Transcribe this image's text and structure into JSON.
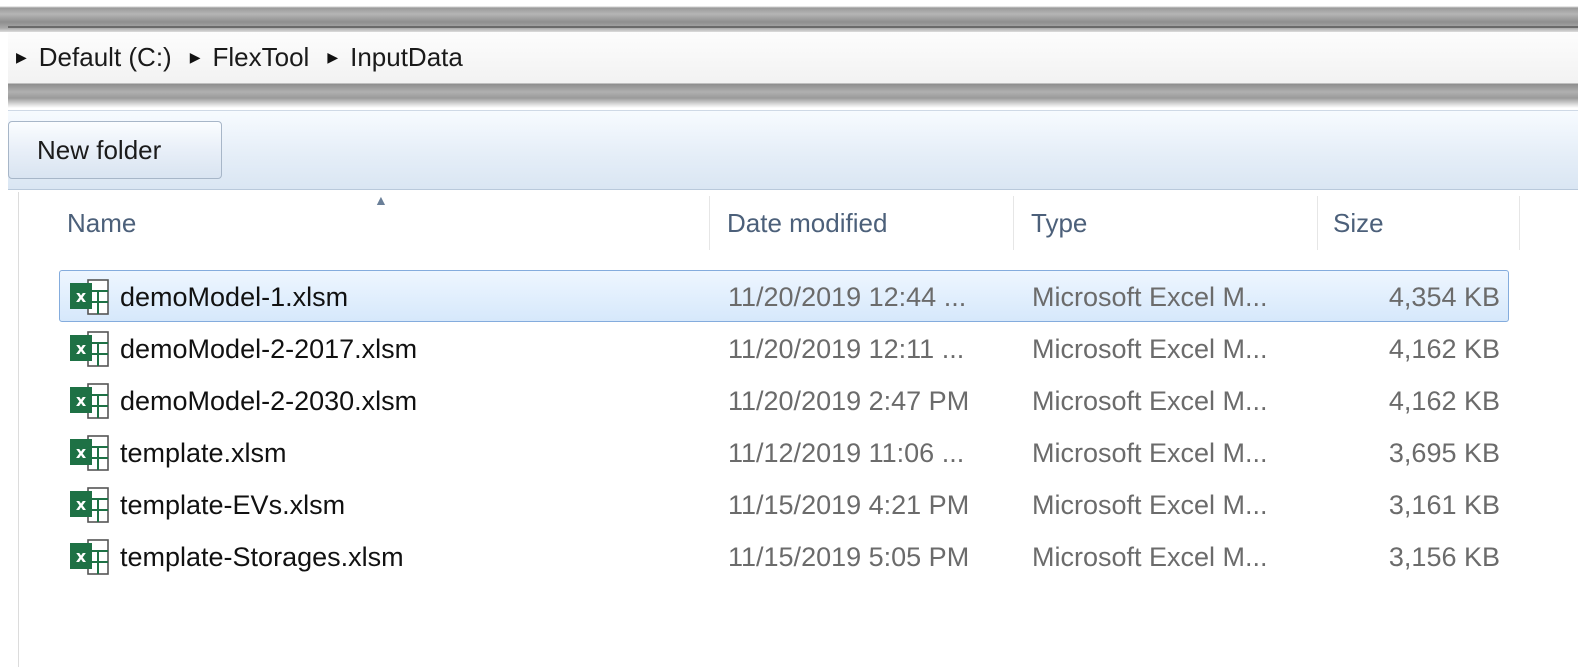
{
  "breadcrumb": {
    "items": [
      "Default (C:)",
      "FlexTool",
      "InputData"
    ]
  },
  "toolbar": {
    "new_folder_label": "New folder"
  },
  "columns": {
    "name": "Name",
    "date": "Date modified",
    "type": "Type",
    "size": "Size"
  },
  "files": [
    {
      "name": "demoModel-1.xlsm",
      "date": "11/20/2019 12:44 ...",
      "type": "Microsoft Excel M...",
      "size": "4,354 KB",
      "selected": true
    },
    {
      "name": "demoModel-2-2017.xlsm",
      "date": "11/20/2019 12:11 ...",
      "type": "Microsoft Excel M...",
      "size": "4,162 KB",
      "selected": false
    },
    {
      "name": "demoModel-2-2030.xlsm",
      "date": "11/20/2019 2:47 PM",
      "type": "Microsoft Excel M...",
      "size": "4,162 KB",
      "selected": false
    },
    {
      "name": "template.xlsm",
      "date": "11/12/2019 11:06 ...",
      "type": "Microsoft Excel M...",
      "size": "3,695 KB",
      "selected": false
    },
    {
      "name": "template-EVs.xlsm",
      "date": "11/15/2019 4:21 PM",
      "type": "Microsoft Excel M...",
      "size": "3,161 KB",
      "selected": false
    },
    {
      "name": "template-Storages.xlsm",
      "date": "11/15/2019 5:05 PM",
      "type": "Microsoft Excel M...",
      "size": "3,156 KB",
      "selected": false
    }
  ],
  "icons": {
    "file": "excel-file-icon",
    "breadcrumb_separator": "triangle-right-icon",
    "sort": "sort-up-icon"
  },
  "colors": {
    "selection_fill": "#d6e8fb",
    "selection_border": "#84acdd",
    "header_text": "#4c607a",
    "excel_green": "#1e7145"
  }
}
